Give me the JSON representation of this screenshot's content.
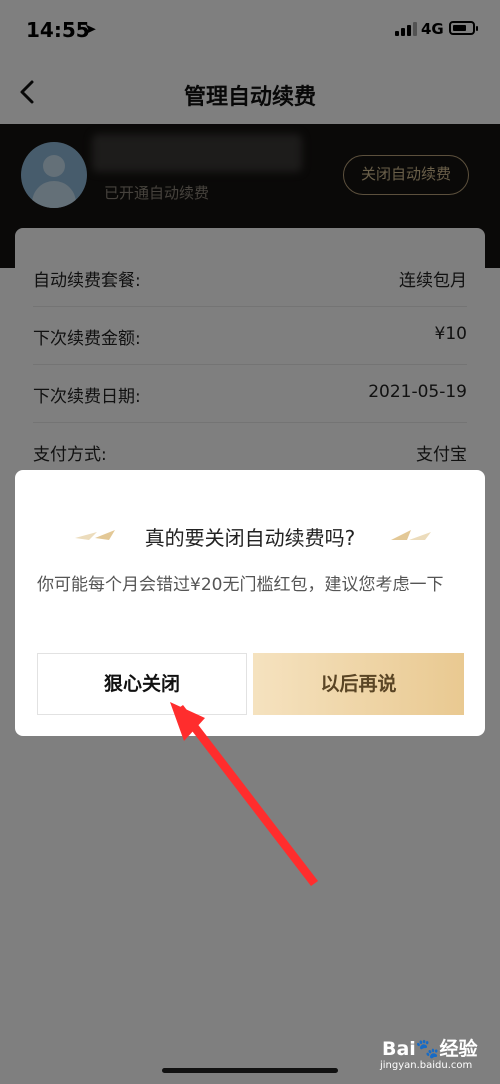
{
  "status_bar": {
    "time": "14:55",
    "location_arrow": "➤",
    "network": "4G"
  },
  "nav": {
    "title": "管理自动续费",
    "back_icon": "chevron-left-icon"
  },
  "user": {
    "status": "已开通自动续费",
    "close_button": "关闭自动续费"
  },
  "details": [
    {
      "label": "自动续费套餐:",
      "value": "连续包月"
    },
    {
      "label": "下次续费金额:",
      "value": "¥10"
    },
    {
      "label": "下次续费日期:",
      "value": "2021-05-19"
    },
    {
      "label": "支付方式:",
      "value": "支付宝"
    }
  ],
  "dialog": {
    "title": "真的要关闭自动续费吗?",
    "message": "你可能每个月会错过¥20无门槛红包，建议您考虑一下",
    "confirm_label": "狠心关闭",
    "cancel_label": "以后再说"
  },
  "watermark": {
    "brand": "Bai",
    "brand_cn": "经验",
    "url": "jingyan.baidu.com"
  },
  "colors": {
    "accent_gold": "#d4be93",
    "button_gradient_start": "#f5e2bf",
    "button_gradient_end": "#e9c991",
    "annotation_arrow": "#ff2d2d",
    "header_dark": "#141210"
  }
}
